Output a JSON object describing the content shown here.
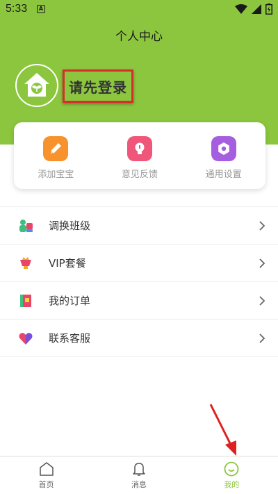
{
  "status_bar": {
    "time": "5:33",
    "notif_glyph": "A"
  },
  "header": {
    "title": "个人中心",
    "login_prompt": "请先登录"
  },
  "actions": [
    {
      "label": "添加宝宝",
      "icon": "pencil-icon",
      "color": "#f7922c"
    },
    {
      "label": "意见反馈",
      "icon": "lightbulb-icon",
      "color": "#f0557a"
    },
    {
      "label": "通用设置",
      "icon": "settings-icon",
      "color": "#a65ee0"
    }
  ],
  "menu": [
    {
      "label": "调换班级",
      "icon": "class-switch-icon"
    },
    {
      "label": "VIP套餐",
      "icon": "vip-cup-icon"
    },
    {
      "label": "我的订单",
      "icon": "order-book-icon"
    },
    {
      "label": "联系客服",
      "icon": "heart-service-icon"
    }
  ],
  "bottom_nav": [
    {
      "label": "首页",
      "icon": "home-icon"
    },
    {
      "label": "消息",
      "icon": "bell-icon"
    },
    {
      "label": "我的",
      "icon": "smile-icon",
      "active": true
    }
  ],
  "colors": {
    "brand_green": "#8cc63f",
    "highlight_red": "#d62d2d"
  }
}
